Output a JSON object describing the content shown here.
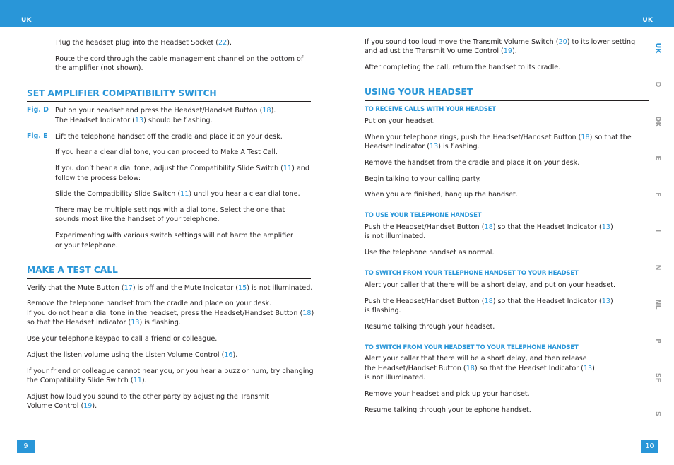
{
  "header": {
    "left_lang": "UK",
    "right_lang": "UK"
  },
  "accent_color": "#2996d8",
  "left_page": {
    "intro": [
      [
        "Plug the headset plug into the Headset Socket (",
        {
          "ref": "22"
        },
        ")."
      ],
      [
        "Route the cord through the cable management channel on the bottom of"
      ],
      [
        "the amplifier (not shown)."
      ]
    ],
    "section1": {
      "title": "SET AMPLIFIER COMPATIBILITY SWITCH",
      "fig_d": "Fig. D",
      "fig_e": "Fig. E",
      "lines": [
        [
          "Put on your headset and press the Headset/Handset Button (",
          {
            "ref": "18"
          },
          ")."
        ],
        [
          "The Headset Indicator (",
          {
            "ref": "13"
          },
          ") should be flashing."
        ],
        [
          "Lift the telephone handset off the cradle and place it on your desk."
        ],
        [
          "If you hear a clear dial tone, you can proceed to Make A Test Call."
        ],
        [
          "If you don’t hear a dial tone, adjust the Compatibility Slide Switch (",
          {
            "ref": "11"
          },
          ") and"
        ],
        [
          "follow the process below:"
        ],
        [
          "Slide the Compatibility Slide Switch (",
          {
            "ref": "11"
          },
          ") until you hear a clear dial tone."
        ],
        [
          "There may be multiple settings with a dial tone. Select the one that"
        ],
        [
          "sounds most like the handset of your telephone."
        ],
        [
          "Experimenting with various switch settings will not harm the amplifier"
        ],
        [
          "or your telephone."
        ]
      ]
    },
    "section2": {
      "title": "MAKE A TEST CALL",
      "lines": [
        [
          "Verify that the Mute Button (",
          {
            "ref": "17"
          },
          ") is off and the Mute Indicator (",
          {
            "ref": "15"
          },
          ") is not illuminated."
        ],
        [
          "Remove the telephone handset from the cradle and place on your desk."
        ],
        [
          "If you do not hear a dial tone in the headset, press the Headset/Handset Button (",
          {
            "ref": "18"
          },
          ")"
        ],
        [
          "so that the Headset Indicator (",
          {
            "ref": "13"
          },
          ") is flashing."
        ],
        [
          "Use your telephone keypad to call a friend or colleague."
        ],
        [
          "Adjust the listen volume using the Listen Volume Control (",
          {
            "ref": "16"
          },
          ")."
        ],
        [
          "If your friend or colleague cannot hear you, or you hear a buzz or hum, try changing"
        ],
        [
          "the Compatibility Slide Switch (",
          {
            "ref": "11"
          },
          ")."
        ],
        [
          "Adjust how loud you sound to the other party by adjusting the Transmit"
        ],
        [
          "Volume Control (",
          {
            "ref": "19"
          },
          ")."
        ]
      ]
    },
    "page_number": "9"
  },
  "right_page": {
    "intro": [
      [
        "If you sound too loud move the Transmit Volume Switch (",
        {
          "ref": "20"
        },
        ") to its lower setting"
      ],
      [
        "and adjust the Transmit Volume Control (",
        {
          "ref": "19"
        },
        ")."
      ],
      [
        "After completing the call, return the handset to its cradle."
      ]
    ],
    "section": {
      "title": "USING YOUR HEADSET",
      "subsections": [
        {
          "title": "TO RECEIVE CALLS WITH YOUR HEADSET",
          "lines": [
            [
              "Put on your headset."
            ],
            [
              "When your telephone rings, push the Headset/Handset Button (",
              {
                "ref": "18"
              },
              ") so that the"
            ],
            [
              "Headset Indicator (",
              {
                "ref": "13"
              },
              ") is flashing."
            ],
            [
              "Remove the handset from the cradle and place it on your desk."
            ],
            [
              "Begin talking to your calling party."
            ],
            [
              "When you are finished, hang up the handset."
            ]
          ]
        },
        {
          "title": "TO USE YOUR TELEPHONE HANDSET",
          "lines": [
            [
              "Push the Headset/Handset Button (",
              {
                "ref": "18"
              },
              ") so that the Headset Indicator (",
              {
                "ref": "13"
              },
              ")"
            ],
            [
              "is not illuminated."
            ],
            [
              "Use the telephone handset as normal."
            ]
          ]
        },
        {
          "title": "TO SWITCH FROM YOUR TELEPHONE HANDSET TO YOUR HEADSET",
          "lines": [
            [
              "Alert your caller that there will be a short delay, and put on your headset."
            ],
            [
              "Push the Headset/Handset Button (",
              {
                "ref": "18"
              },
              ") so that the Headset Indicator (",
              {
                "ref": "13"
              },
              ")"
            ],
            [
              "is flashing."
            ],
            [
              "Resume talking through your headset."
            ]
          ]
        },
        {
          "title": "TO SWITCH FROM YOUR HEADSET TO YOUR TELEPHONE HANDSET",
          "lines": [
            [
              "Alert your caller that there will be a short delay, and then release"
            ],
            [
              "the Headset/Handset Button (",
              {
                "ref": "18"
              },
              ") so that the Headset Indicator (",
              {
                "ref": "13"
              },
              ")"
            ],
            [
              "is not illuminated."
            ],
            [
              "Remove your headset and pick up your handset."
            ],
            [
              "Resume talking through your telephone handset."
            ]
          ]
        }
      ]
    },
    "page_number": "10"
  },
  "language_tabs": [
    {
      "label": "UK",
      "active": true
    },
    {
      "label": "D",
      "active": false
    },
    {
      "label": "DK",
      "active": false
    },
    {
      "label": "E",
      "active": false
    },
    {
      "label": "F",
      "active": false
    },
    {
      "label": "I",
      "active": false
    },
    {
      "label": "N",
      "active": false
    },
    {
      "label": "NL",
      "active": false
    },
    {
      "label": "P",
      "active": false
    },
    {
      "label": "SF",
      "active": false
    },
    {
      "label": "S",
      "active": false
    }
  ]
}
